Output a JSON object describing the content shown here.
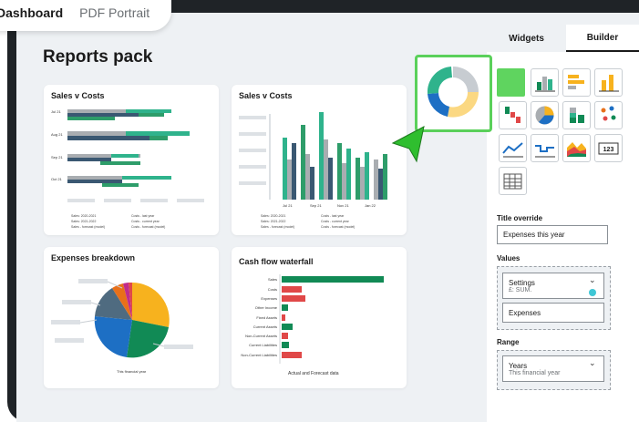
{
  "header": {
    "tab_dashboard": "Dashboard",
    "tab_pdf": "PDF Portrait"
  },
  "page": {
    "title": "Reports pack"
  },
  "cards": {
    "sales_costs_1": {
      "title": "Sales v Costs",
      "categories": [
        "Jul 21",
        "Aug 21",
        "Sep 21",
        "Oct 21"
      ],
      "legend": [
        "Sales: 2020-2021",
        "Sales: 2021-2022",
        "Sales - forecast (model)",
        "Costs - last year",
        "Costs - current year",
        "Costs - forecast (model)"
      ]
    },
    "sales_costs_2": {
      "title": "Sales v Costs",
      "ticks": [
        "Jul 21",
        "Sep 21",
        "Nov 21",
        "Jan 22"
      ],
      "legend": [
        "Sales: 2020-2021",
        "Sales: 2021-2022",
        "Sales - forecast (model)",
        "Costs - last year",
        "Costs - current year",
        "Costs - forecast (model)"
      ]
    },
    "expenses": {
      "title": "Expenses breakdown",
      "caption": "This financial year"
    },
    "cashflow": {
      "title": "Cash flow waterfall",
      "caption": "Actual and Forecast data",
      "rows": [
        "Sales",
        "Costs",
        "Expenses",
        "Other Income",
        "Fixed Assets",
        "Current Assets",
        "Non-Current Assets",
        "Current Liabilities",
        "Non-Current Liabilities"
      ]
    }
  },
  "panel": {
    "tab_widgets": "Widgets",
    "tab_builder": "Builder",
    "icons": [
      "donut-chart-icon",
      "bar-chart-icon",
      "horizontal-bar-icon",
      "column-chart-icon",
      "waterfall-icon",
      "pie-chart-icon",
      "stacked-bar-icon",
      "scatter-icon",
      "line-chart-icon",
      "step-chart-icon",
      "area-chart-icon",
      "number-kpi-icon",
      "table-icon"
    ],
    "kpi_text": "123",
    "title_override_label": "Title override",
    "title_override_value": "Expenses this year",
    "values_label": "Values",
    "values_item1": "Settings",
    "values_item1_sub": "£: SUM.",
    "values_item2": "Expenses",
    "range_label": "Range",
    "range_value": "Years",
    "range_sub": "This financial year"
  },
  "colors": {
    "green": "#2e9d6a",
    "teal": "#2fb38c",
    "grey": "#a9adb1",
    "navy": "#3a5872",
    "red": "#e04848",
    "blue": "#1d6fc4",
    "orange": "#f7b21e",
    "highlight": "#5ad05a"
  }
}
